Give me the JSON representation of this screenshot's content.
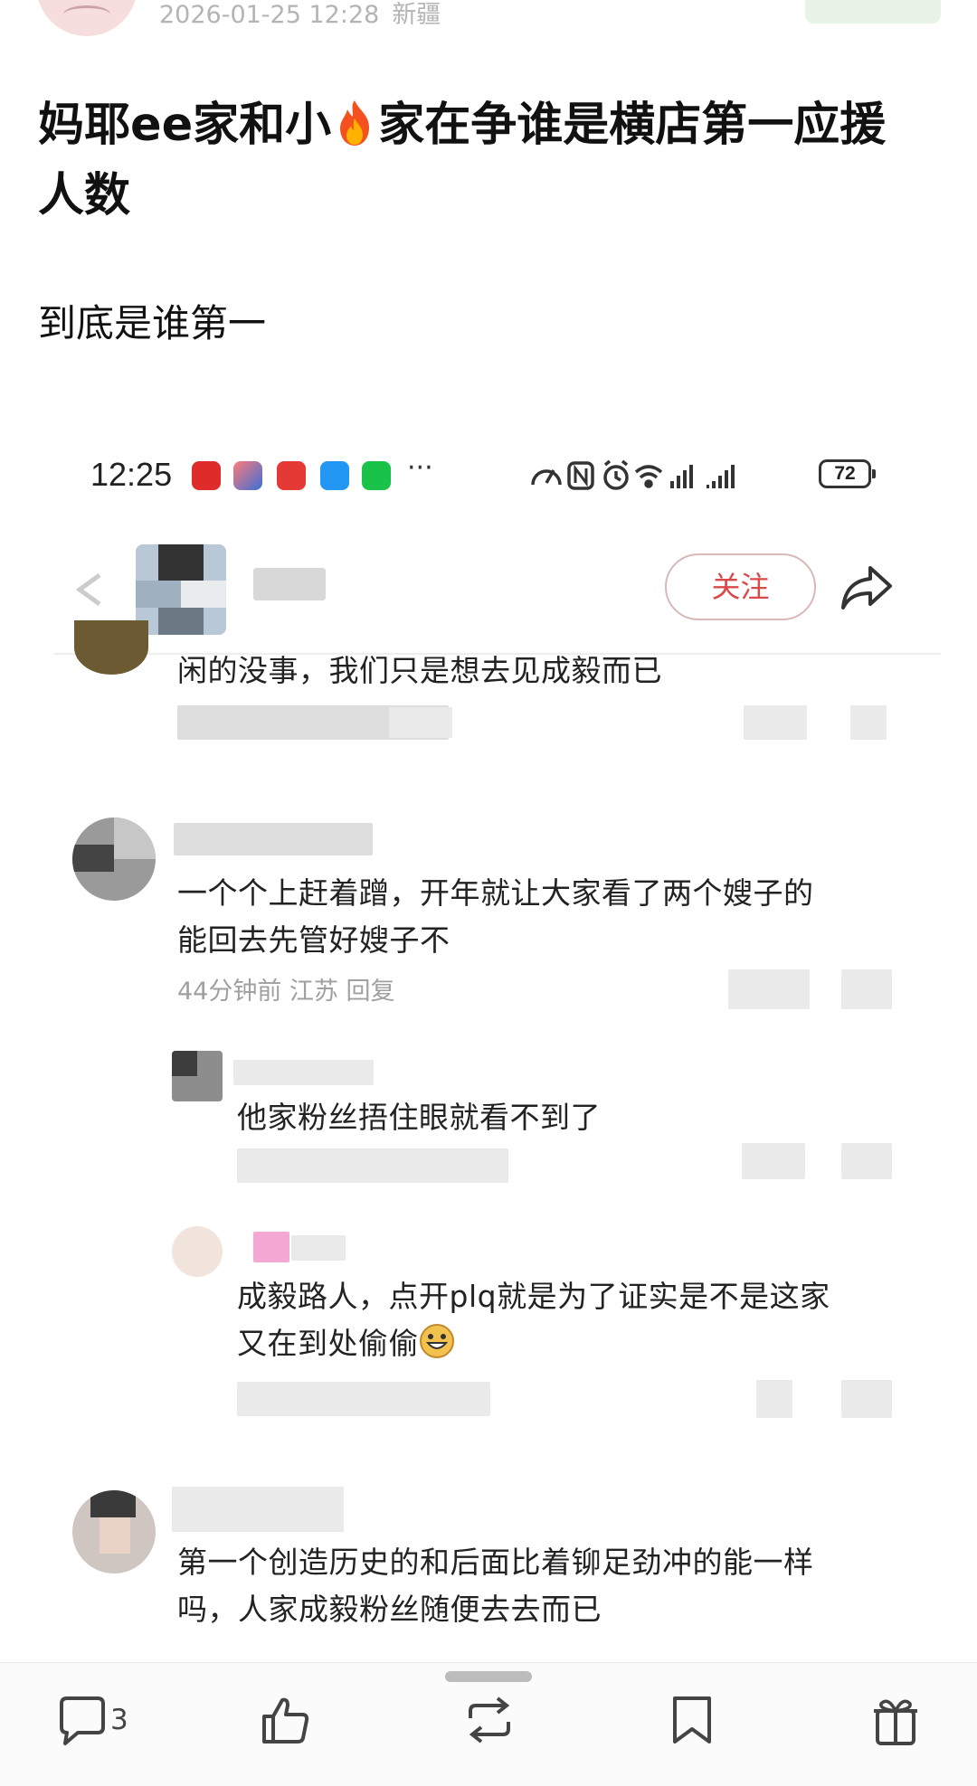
{
  "post": {
    "timestamp": "2026-01-25 12:28",
    "region": "新疆",
    "title_part1": "妈耶ee家和小",
    "title_icon": "fire-emoji",
    "title_part2": "家在争谁是横店第一应援人数",
    "body": "到底是谁第一"
  },
  "inner_screen": {
    "status_bar": {
      "time": "12:25",
      "more": "···",
      "battery": "72",
      "app_icons": [
        "huawei-appgallery-icon",
        "game-app-icon",
        "red-app-icon",
        "message-bubble-icon",
        "wechat-icon"
      ],
      "system_icons": [
        "speed-icon",
        "nfc-icon",
        "alarm-icon",
        "wifi-icon",
        "signal-icon",
        "signal-icon"
      ]
    },
    "header": {
      "follow_label": "关注"
    },
    "comments": [
      {
        "text": "闲的没事，我们只是想去见成毅而已"
      },
      {
        "text_line1": "一个个上赶着蹭，开年就让大家看了两个嫂子的",
        "text_line2": "能回去先管好嫂子不",
        "meta": "44分钟前 江苏 回复"
      },
      {
        "text": "他家粉丝捂住眼就看不到了"
      },
      {
        "text_line1": "成毅路人，点开plq就是为了证实是不是这家",
        "text_line2": "又在到处偷偷",
        "emoji": "grin-emoji"
      },
      {
        "text_line1": "第一个创造历史的和后面比着铆足劲冲的能一样",
        "text_line2": "吗，人家成毅粉丝随便去去而已"
      }
    ]
  },
  "bottom_bar": {
    "comment_count": "3",
    "icons": [
      "comment-icon",
      "like-icon",
      "repost-icon",
      "bookmark-icon",
      "gift-icon"
    ]
  },
  "colors": {
    "follow_red": "#d84a4a",
    "meta_gray": "#b4b4b4"
  }
}
